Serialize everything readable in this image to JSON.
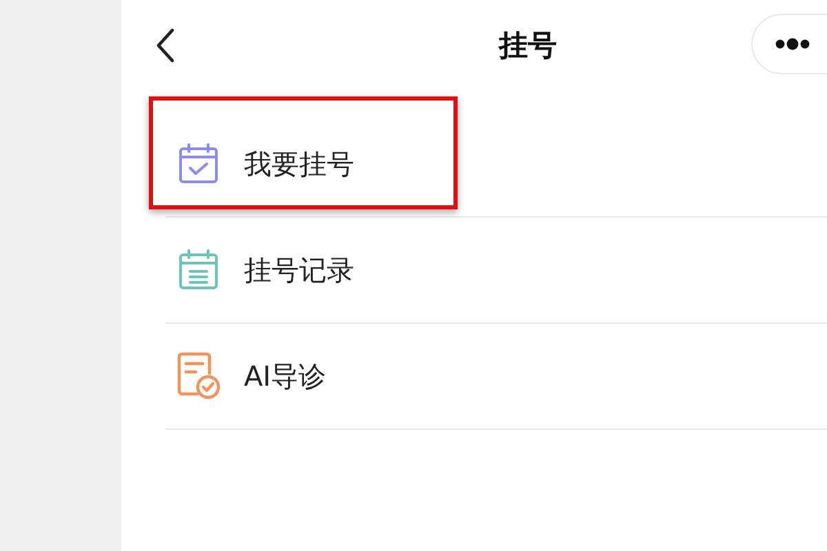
{
  "header": {
    "title": "挂号"
  },
  "items": [
    {
      "kind": "register",
      "label": "我要挂号",
      "highlighted": true
    },
    {
      "kind": "records",
      "label": "挂号记录",
      "highlighted": false
    },
    {
      "kind": "ai",
      "label": "AI导诊",
      "highlighted": false
    }
  ]
}
